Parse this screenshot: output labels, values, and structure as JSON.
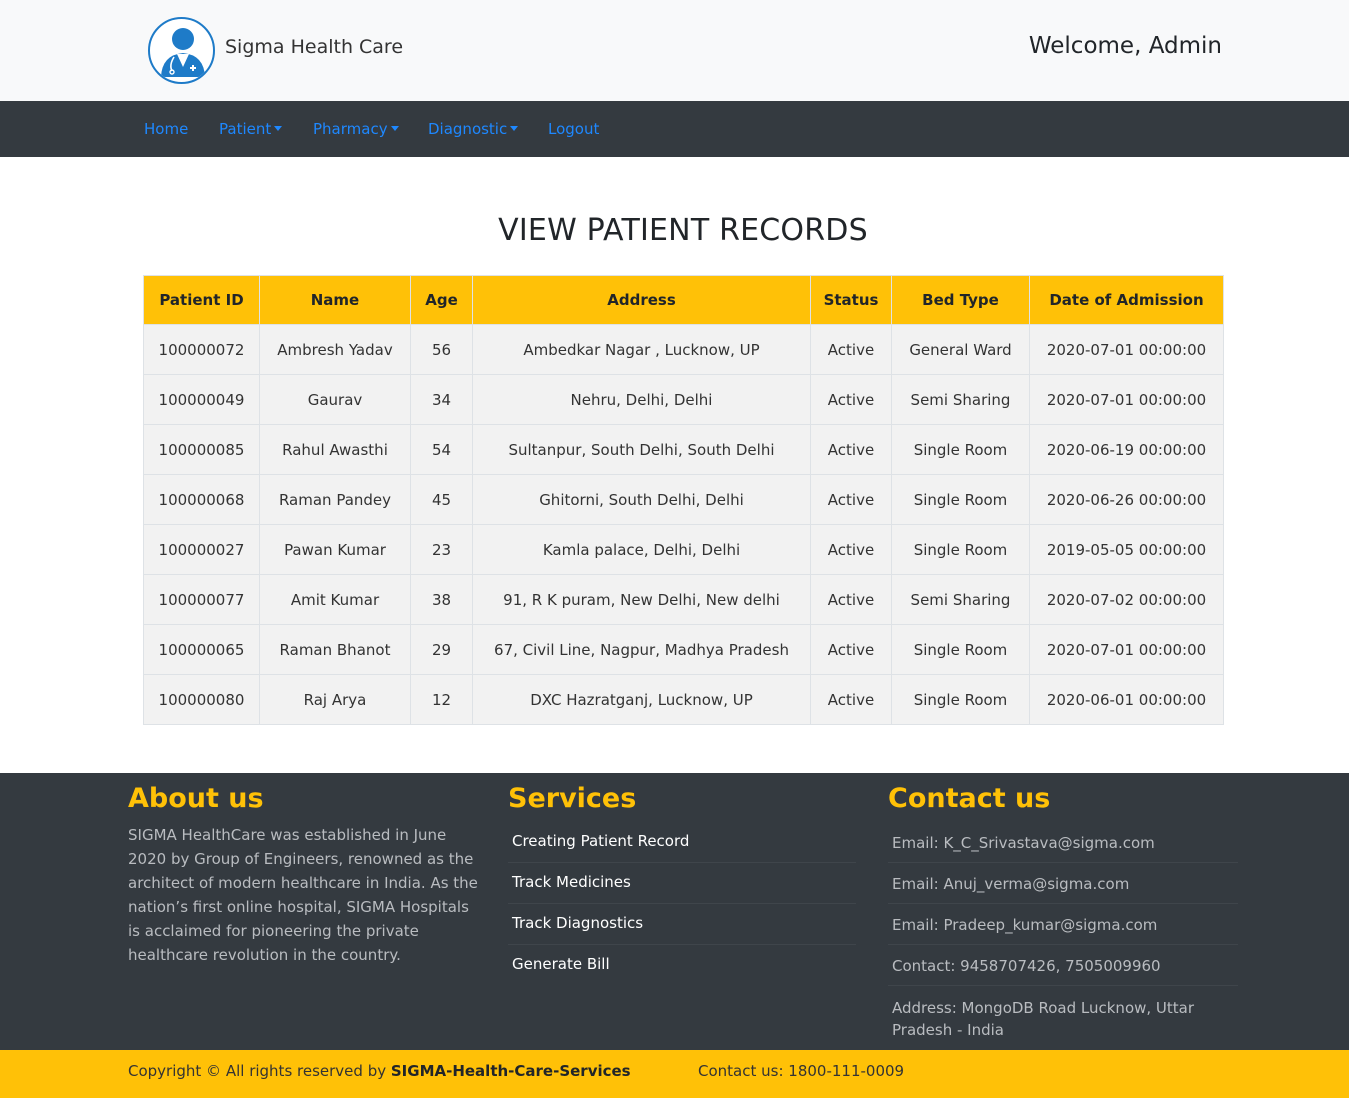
{
  "header": {
    "brand": "Sigma Health Care",
    "welcome": "Welcome, Admin",
    "logo_icon": "doctor-avatar-icon"
  },
  "nav": {
    "home": "Home",
    "patient": "Patient",
    "pharmacy": "Pharmacy",
    "diagnostic": "Diagnostic",
    "logout": "Logout"
  },
  "main": {
    "title": "VIEW PATIENT RECORDS",
    "table": {
      "headers": [
        "Patient ID",
        "Name",
        "Age",
        "Address",
        "Status",
        "Bed Type",
        "Date of Admission"
      ],
      "rows": [
        [
          "100000072",
          "Ambresh Yadav",
          "56",
          "Ambedkar Nagar , Lucknow, UP",
          "Active",
          "General Ward",
          "2020-07-01 00:00:00"
        ],
        [
          "100000049",
          "Gaurav",
          "34",
          "Nehru, Delhi, Delhi",
          "Active",
          "Semi Sharing",
          "2020-07-01 00:00:00"
        ],
        [
          "100000085",
          "Rahul Awasthi",
          "54",
          "Sultanpur, South Delhi, South Delhi",
          "Active",
          "Single Room",
          "2020-06-19 00:00:00"
        ],
        [
          "100000068",
          "Raman Pandey",
          "45",
          "Ghitorni, South Delhi, Delhi",
          "Active",
          "Single Room",
          "2020-06-26 00:00:00"
        ],
        [
          "100000027",
          "Pawan Kumar",
          "23",
          "Kamla palace, Delhi, Delhi",
          "Active",
          "Single Room",
          "2019-05-05 00:00:00"
        ],
        [
          "100000077",
          "Amit Kumar",
          "38",
          "91, R K puram, New Delhi, New delhi",
          "Active",
          "Semi Sharing",
          "2020-07-02 00:00:00"
        ],
        [
          "100000065",
          "Raman Bhanot",
          "29",
          "67, Civil Line, Nagpur, Madhya Pradesh",
          "Active",
          "Single Room",
          "2020-07-01 00:00:00"
        ],
        [
          "100000080",
          "Raj Arya",
          "12",
          "DXC Hazratganj, Lucknow, UP",
          "Active",
          "Single Room",
          "2020-06-01 00:00:00"
        ]
      ]
    }
  },
  "footer": {
    "about_title": "About us",
    "about_text": "SIGMA HealthCare was established in June 2020 by Group of Engineers, renowned as the architect of modern healthcare in India. As the nation’s first online hospital, SIGMA Hospitals is acclaimed for pioneering the private healthcare revolution in the country.",
    "services_title": "Services",
    "services": [
      "Creating Patient Record",
      "Track Medicines",
      "Track Diagnostics",
      "Generate Bill"
    ],
    "contact_title": "Contact us",
    "contacts": [
      "Email: K_C_Srivastava@sigma.com",
      "Email: Anuj_verma@sigma.com",
      "Email: Pradeep_kumar@sigma.com",
      "Contact: 9458707426, 7505009960",
      "Address: MongoDB Road Lucknow, Uttar Pradesh - India"
    ]
  },
  "bottom": {
    "copyright_prefix": "Copyright © All rights reserved by",
    "company": "SIGMA-Health-Care-Services",
    "hotline": "Contact us: 1800-111-0009"
  },
  "colors": {
    "accent": "#ffc107",
    "dark": "#343a40",
    "link": "#1e88ff",
    "logo_blue": "#1e7bc8"
  }
}
